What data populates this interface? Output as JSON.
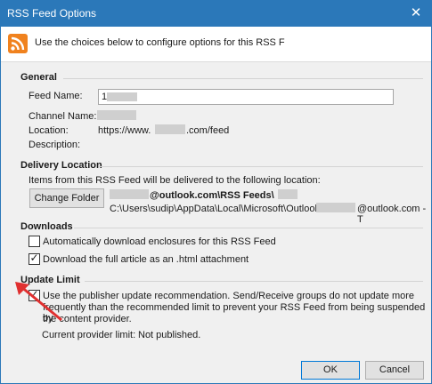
{
  "window": {
    "title": "RSS Feed Options",
    "close_glyph": "✕"
  },
  "header": {
    "text": "Use the choices below to configure options for this RSS F",
    "icon": "rss-feed-icon"
  },
  "general": {
    "heading": "General",
    "feed_name_label": "Feed Name:",
    "feed_name_value": "1",
    "channel_name_label": "Channel Name:",
    "location_label": "Location:",
    "location_prefix": "https://www.",
    "location_suffix": ".com/feed",
    "description_label": "Description:"
  },
  "delivery": {
    "heading": "Delivery Location",
    "intro": "Items from this RSS Feed will be delivered to the following location:",
    "change_folder_button": "Change Folder",
    "folder_path": "@outlook.com\\RSS Feeds\\",
    "pst_path_prefix": "C:\\Users\\sudip\\AppData\\Local\\Microsoft\\Outlook\\",
    "pst_path_suffix": "@outlook.com - T"
  },
  "downloads": {
    "heading": "Downloads",
    "enclosures": {
      "label": "Automatically download enclosures for this RSS Feed",
      "checked": false
    },
    "full_article": {
      "label": "Download the full article as an .html attachment",
      "checked": true
    }
  },
  "update_limit": {
    "heading": "Update Limit",
    "checkbox": {
      "line1": "Use the publisher update recommendation. Send/Receive groups do not update more",
      "line2": "frequently than the recommended limit to prevent your RSS Feed from being suspended by",
      "line3": "the content provider.",
      "checked": true
    },
    "current_limit_label": "Current provider limit:",
    "current_limit_value": "Not published."
  },
  "buttons": {
    "ok": "OK",
    "cancel": "Cancel"
  },
  "colors": {
    "titlebar": "#2b78b9",
    "annotation_arrow": "#e03030",
    "dialog_bg": "#f0f0f0"
  }
}
